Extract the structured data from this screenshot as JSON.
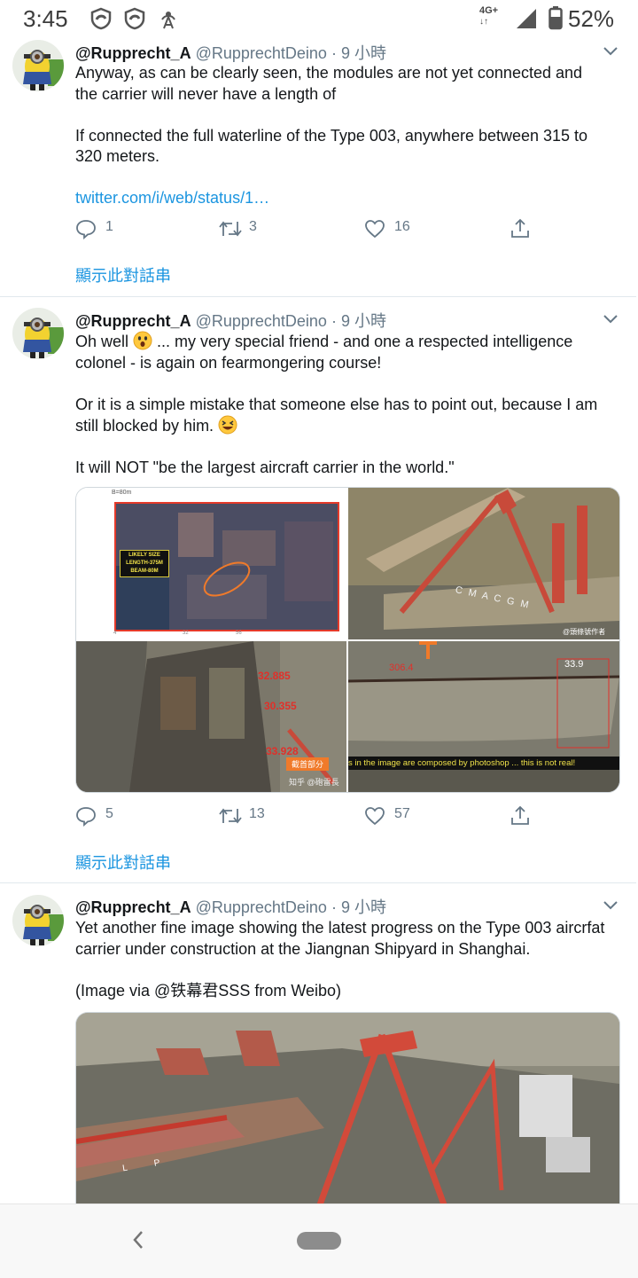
{
  "status_bar": {
    "time": "3:45",
    "network": "4G+",
    "battery": "52%",
    "icons": [
      "shield-icon",
      "shield-icon",
      "hotspot-icon",
      "signal-icon",
      "battery-icon"
    ]
  },
  "tweets": [
    {
      "name": "@Rupprecht_A",
      "handle": "@RupprechtDeino",
      "time": "· 9 小時",
      "text1": "Anyway, as can be clearly seen, the modules are not yet connected and the carrier will never have a length of",
      "text2": "If connected the full waterline of the Type 003, anywhere between 315 to 320 meters.",
      "link": "twitter.com/i/web/status/1…",
      "replies": "1",
      "retweets": "3",
      "likes": "16",
      "thread_label": "顯示此對話串"
    },
    {
      "name": "@Rupprecht_A",
      "handle": "@RupprechtDeino",
      "time": "· 9 小時",
      "text1a": "Oh well ",
      "text1b": " ... my very special friend - and one a respected intelligence colonel - is again on fearmongering course!",
      "text2a": "Or it is a simple mistake that someone else has to point out, because I am still blocked by him. ",
      "text3": "It will NOT \"be the largest aircraft carrier in the world.\"",
      "media_texts": {
        "beam_note": "B=80m",
        "likely_size": "LIKELY SIZE",
        "length": "LENGTH-375M",
        "beam": "BEAM-80M",
        "inner_likes": [
          "4",
          "32",
          "56"
        ],
        "hull_mark": "C M A  C G M",
        "watermark": "@頭條號作者",
        "m1": "32.885",
        "m2": "30.355",
        "m3": "33.928",
        "tag": "截首部分",
        "zhihu": "知乎 @砲雷長",
        "m4": "306.4",
        "m5": "33.9",
        "caption": "s in the image are composed by photoshop ... this is not real!"
      },
      "replies": "5",
      "retweets": "13",
      "likes": "57",
      "thread_label": "顯示此對話串"
    },
    {
      "name": "@Rupprecht_A",
      "handle": "@RupprechtDeino",
      "time": "· 9 小時",
      "text1": "Yet another fine image showing the latest progress on the Type 003 aircrfat carrier under construction at the Jiangnan Shipyard in Shanghai.",
      "text2": "(Image via @铁幕君SSS from Weibo)",
      "hull_letters": "L P"
    }
  ],
  "colors": {
    "accent": "#1b95e0",
    "muted": "#657786",
    "text": "#14171a"
  }
}
